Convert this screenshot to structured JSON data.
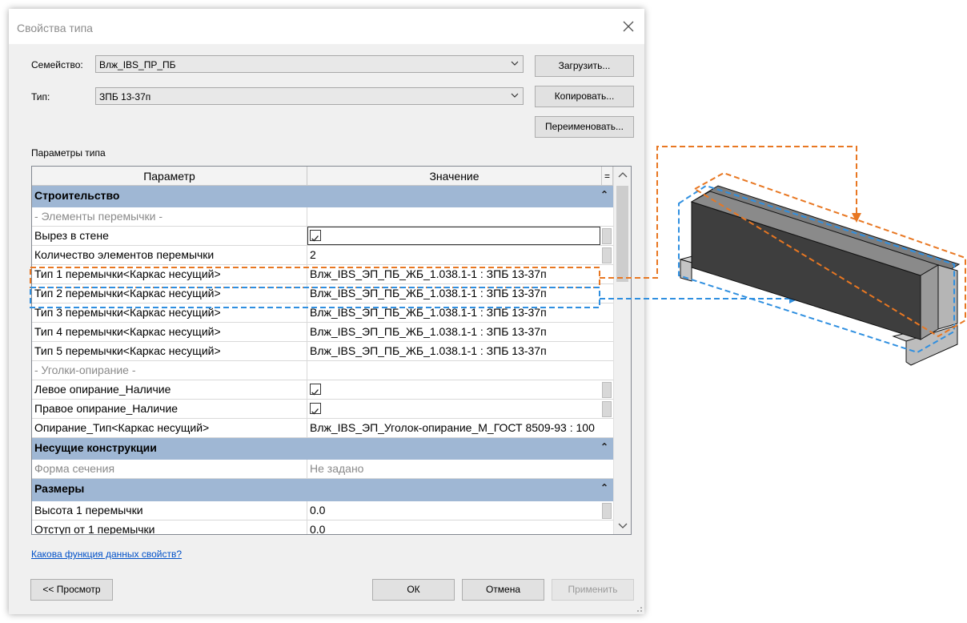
{
  "dialog": {
    "title": "Свойства типа",
    "family_label": "Семейство:",
    "family_value": "Влж_IBS_ПР_ПБ",
    "type_label": "Тип:",
    "type_value": "ЗПБ 13-37п",
    "load_button": "Загрузить...",
    "copy_button": "Копировать...",
    "rename_button": "Переименовать...",
    "params_label": "Параметры типа",
    "help_link": "Какова функция данных свойств?",
    "preview_button": "<< Просмотр",
    "ok_button": "ОК",
    "cancel_button": "Отмена",
    "apply_button": "Применить"
  },
  "grid": {
    "col_param": "Параметр",
    "col_value": "Значение",
    "col_eq": "=",
    "groups": {
      "construction": "Строительство",
      "load_bearing": "Несущие конструкции",
      "dimensions": "Размеры"
    },
    "rows": {
      "sub_elements": "- Элементы перемычки -",
      "cut_label": "Вырез в стене",
      "count_label": "Количество элементов перемычки",
      "count_value": "2",
      "type1_label": "Тип 1 перемычки<Каркас несущий>",
      "type1_value": "Влж_IBS_ЭП_ПБ_ЖБ_1.038.1-1 : ЗПБ 13-37п",
      "type2_label": "Тип 2 перемычки<Каркас несущий>",
      "type2_value": "Влж_IBS_ЭП_ПБ_ЖБ_1.038.1-1 : ЗПБ 13-37п",
      "type3_label": "Тип 3 перемычки<Каркас несущий>",
      "type3_value": "Влж_IBS_ЭП_ПБ_ЖБ_1.038.1-1 : ЗПБ 13-37п",
      "type4_label": "Тип 4 перемычки<Каркас несущий>",
      "type4_value": "Влж_IBS_ЭП_ПБ_ЖБ_1.038.1-1 : ЗПБ 13-37п",
      "type5_label": "Тип 5 перемычки<Каркас несущий>",
      "type5_value": "Влж_IBS_ЭП_ПБ_ЖБ_1.038.1-1 : ЗПБ 13-37п",
      "sub_angles": "- Уголки-опирание -",
      "left_label": "Левое опирание_Наличие",
      "right_label": "Правое опирание_Наличие",
      "support_label": "Опирание_Тип<Каркас несущий>",
      "support_value": "Влж_IBS_ЭП_Уголок-опирание_М_ГОСТ 8509-93 : 100",
      "section_label": "Форма сечения",
      "section_value": "Не задано",
      "height_label": "Высота 1 перемычки",
      "height_value": "0.0",
      "offset_label": "Отступ от 1 перемычки",
      "offset_value": "0.0"
    }
  },
  "colors": {
    "group_band": "#9fb7d4",
    "highlight_orange": "#e87722",
    "highlight_blue": "#2f8fe0",
    "link": "#0050c8"
  }
}
